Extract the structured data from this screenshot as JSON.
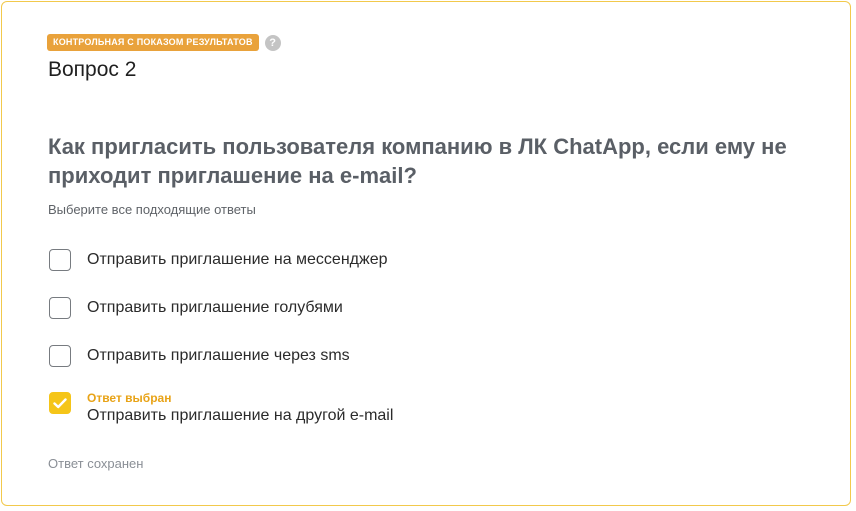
{
  "badge": {
    "label": "КОНТРОЛЬНАЯ С ПОКАЗОМ РЕЗУЛЬТАТОВ",
    "help_glyph": "?"
  },
  "question": {
    "number_label": "Вопрос 2",
    "text": "Как пригласить пользователя компанию в ЛК ChatApp, если ему не приходит приглашение на e-mail?",
    "hint": "Выберите все подходящие ответы"
  },
  "options": [
    {
      "label": "Отправить приглашение на мессенджер",
      "checked": false
    },
    {
      "label": "Отправить приглашение голубями",
      "checked": false
    },
    {
      "label": "Отправить приглашение через sms",
      "checked": false
    },
    {
      "label": "Отправить приглашение на другой e-mail",
      "checked": true,
      "note": "Ответ выбран"
    }
  ],
  "status": {
    "saved": "Ответ сохранен"
  },
  "colors": {
    "accent": "#f5c518",
    "badge": "#e9a23b",
    "border": "#f2c94c"
  }
}
